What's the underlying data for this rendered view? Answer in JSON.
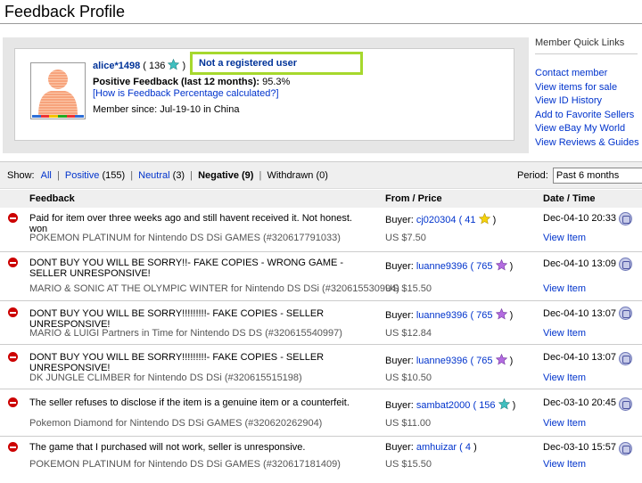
{
  "page": {
    "title": "Feedback Profile"
  },
  "profile": {
    "username": "alice*1498",
    "score_open": "(",
    "score": "136",
    "score_close": ")",
    "registration": "Not a registered user",
    "positive_label": "Positive Feedback (last 12 months):",
    "positive_value": "95.3%",
    "calc_link": "[How is Feedback Percentage calculated?]",
    "member_since": "Member since: Jul-19-10 in China",
    "star_color": "#3fbfbf"
  },
  "quick_links": {
    "title": "Member Quick Links",
    "items": [
      "Contact member",
      "View items for sale",
      "View ID History",
      "Add to Favorite Sellers",
      "View eBay My World",
      "View Reviews & Guides"
    ]
  },
  "filters": {
    "show_label": "Show:",
    "all": "All",
    "positive": "Positive",
    "positive_count": "(155)",
    "neutral": "Neutral",
    "neutral_count": "(3)",
    "negative": "Negative (9)",
    "withdrawn": "Withdrawn (0)",
    "period_label": "Period:",
    "period_value": "Past 6 months"
  },
  "columns": {
    "feedback": "Feedback",
    "from_price": "From / Price",
    "date_time": "Date / Time"
  },
  "rows": [
    {
      "comment": "Paid for item over three weeks ago and still havent received it. Not honest. won",
      "item": "POKEMON PLATINUM for Nintendo DS DSi GAMES (#320617791033)",
      "buyer_label": "Buyer:",
      "buyer": "cj020304",
      "buyer_score": "( 41",
      "buyer_close": ")",
      "star": "yellow",
      "price": "US $7.50",
      "date": "Dec-04-10 20:33",
      "view": "View Item"
    },
    {
      "comment": "DONT BUY YOU WILL BE SORRY!!- FAKE COPIES - WRONG GAME - SELLER UNRESPONSIVE!",
      "item": "MARIO & SONIC AT THE OLYMPIC WINTER for Nintendo DS DSi (#320615530994)",
      "buyer_label": "Buyer:",
      "buyer": "luanne9396",
      "buyer_score": "( 765",
      "buyer_close": ")",
      "star": "purple",
      "price": "US $15.50",
      "date": "Dec-04-10 13:09",
      "view": "View Item"
    },
    {
      "comment": "DONT BUY YOU WILL BE SORRY!!!!!!!!!- FAKE COPIES - SELLER UNRESPONSIVE!",
      "item": "MARIO & LUIGI Partners in Time for Nintendo DS DS (#320615540997)",
      "buyer_label": "Buyer:",
      "buyer": "luanne9396",
      "buyer_score": "( 765",
      "buyer_close": ")",
      "star": "purple",
      "price": "US $12.84",
      "date": "Dec-04-10 13:07",
      "view": "View Item"
    },
    {
      "comment": "DONT BUY YOU WILL BE SORRY!!!!!!!!!- FAKE COPIES - SELLER UNRESPONSIVE!",
      "item": "DK JUNGLE CLIMBER for Nintendo DS DSi (#320615515198)",
      "buyer_label": "Buyer:",
      "buyer": "luanne9396",
      "buyer_score": "( 765",
      "buyer_close": ")",
      "star": "purple",
      "price": "US $10.50",
      "date": "Dec-04-10 13:07",
      "view": "View Item"
    },
    {
      "comment": "The seller refuses to disclose if the item is a genuine item or a counterfeit.",
      "item": "Pokemon Diamond for Nintendo DS DSi GAMES (#320620262904)",
      "buyer_label": "Buyer:",
      "buyer": "sambat2000",
      "buyer_score": "( 156",
      "buyer_close": ")",
      "star": "teal",
      "price": "US $11.00",
      "date": "Dec-03-10 20:45",
      "view": "View Item"
    },
    {
      "comment": "The game that I purchased will not work, seller is unresponsive.",
      "item": "POKEMON PLATINUM for Nintendo DS DSi GAMES (#320617181409)",
      "buyer_label": "Buyer:",
      "buyer": "amhuizar",
      "buyer_score": "( 4",
      "buyer_close": ")",
      "star": "",
      "price": "US $15.50",
      "date": "Dec-03-10 15:57",
      "view": "View Item"
    }
  ],
  "colors": {
    "link": "#0033cc",
    "negative": "#cc0000",
    "highlight_border": "#a6d82d",
    "panel_bg": "#e6e6e6",
    "bar_bg": "#efefef"
  }
}
